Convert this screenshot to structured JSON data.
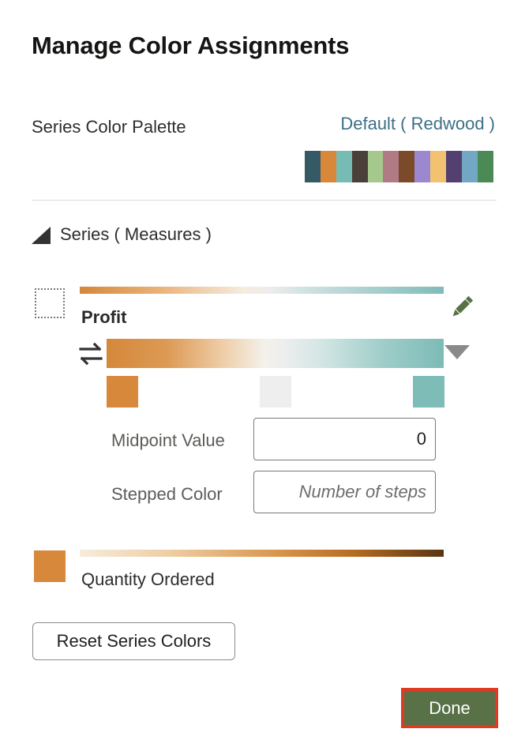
{
  "dialog": {
    "title": "Manage Color Assignments"
  },
  "palette": {
    "label": "Series Color Palette",
    "selected": "Default ( Redwood )",
    "swatches": [
      "#365966",
      "#d8883a",
      "#77bbb5",
      "#4b4039",
      "#a5c98c",
      "#b07b85",
      "#7b4a28",
      "#9c88ce",
      "#f2c270",
      "#533f70",
      "#73a8c4",
      "#4b8a55"
    ]
  },
  "series_section": {
    "label": "Series ( Measures )",
    "items": [
      {
        "name": "Profit",
        "midpoint_label": "Midpoint Value",
        "midpoint_value": "0",
        "stepped_label": "Stepped Color",
        "stepped_placeholder": "Number of steps",
        "stops": [
          "#d8883a",
          "#eeeeee",
          "#7dbcb7"
        ]
      },
      {
        "name": "Quantity Ordered",
        "color": "#d8883a"
      }
    ]
  },
  "buttons": {
    "reset": "Reset Series Colors",
    "done": "Done"
  },
  "colors": {
    "done_bg": "#587146",
    "highlight": "#e03a22",
    "link": "#3c6f86"
  }
}
